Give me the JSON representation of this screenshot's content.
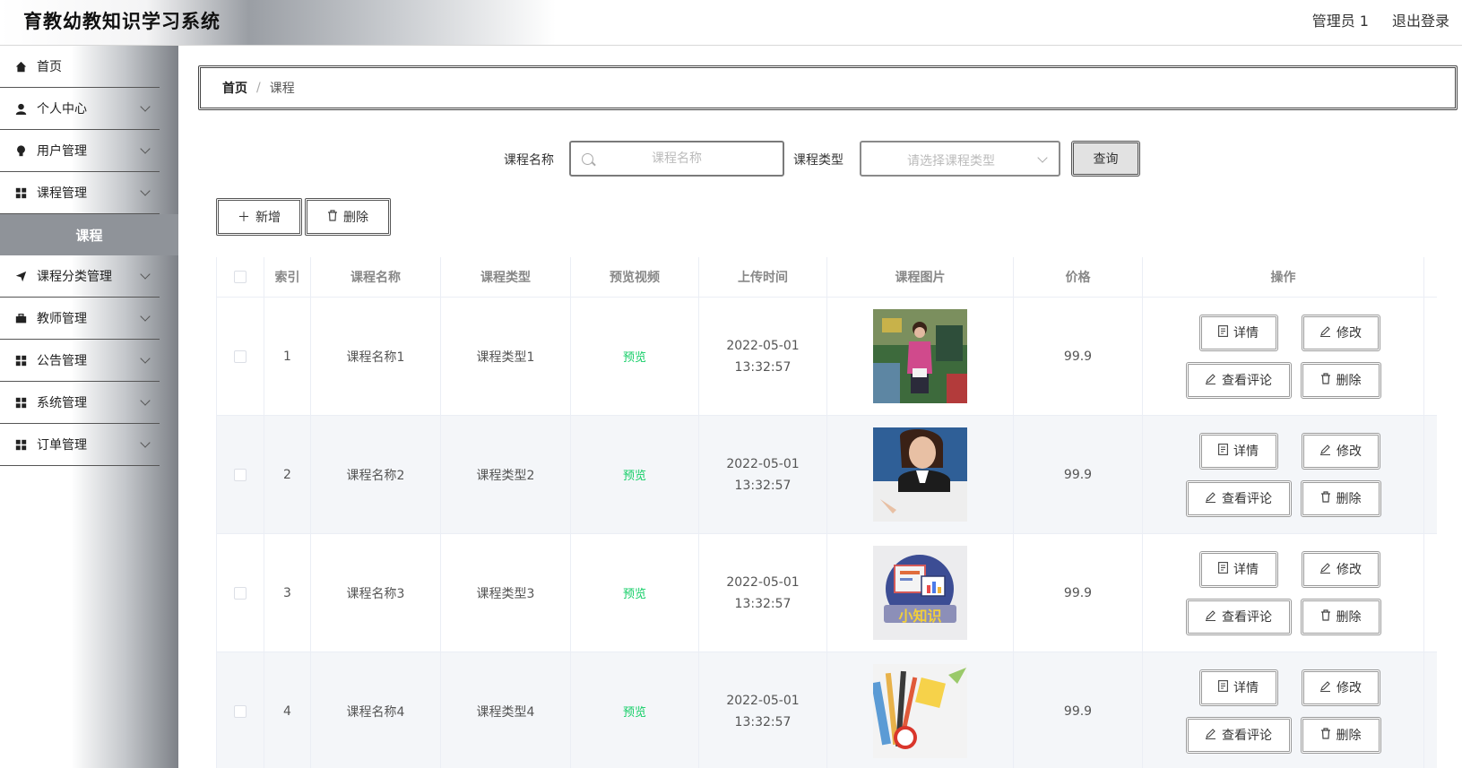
{
  "header": {
    "title": "育教幼教知识学习系统",
    "user": "管理员 1",
    "logout": "退出登录"
  },
  "sidebar": {
    "items": [
      {
        "label": "首页",
        "icon": "home-icon",
        "expandable": false
      },
      {
        "label": "个人中心",
        "icon": "user-icon",
        "expandable": true
      },
      {
        "label": "用户管理",
        "icon": "bulb-icon",
        "expandable": true
      },
      {
        "label": "课程管理",
        "icon": "grid-icon",
        "expandable": true,
        "sub": "课程"
      },
      {
        "label": "课程分类管理",
        "icon": "send-icon",
        "expandable": true
      },
      {
        "label": "教师管理",
        "icon": "briefcase-icon",
        "expandable": true
      },
      {
        "label": "公告管理",
        "icon": "grid-icon",
        "expandable": true
      },
      {
        "label": "系统管理",
        "icon": "grid-icon",
        "expandable": true
      },
      {
        "label": "订单管理",
        "icon": "grid-icon",
        "expandable": true
      }
    ]
  },
  "breadcrumb": {
    "home": "首页",
    "separator": "/",
    "current": "课程"
  },
  "search": {
    "name_label": "课程名称",
    "name_placeholder": "课程名称",
    "name_value": "",
    "type_label": "课程类型",
    "type_placeholder": "请选择课程类型",
    "query_button": "查询"
  },
  "actions": {
    "add": "新增",
    "delete": "删除"
  },
  "table": {
    "columns": [
      "索引",
      "课程名称",
      "课程类型",
      "预览视频",
      "上传时间",
      "课程图片",
      "价格",
      "操作"
    ],
    "rows": [
      {
        "index": "1",
        "name": "课程名称1",
        "type": "课程类型1",
        "preview": "预览",
        "time": "2022-05-01 13:32:57",
        "image": "classroom-teacher-photo",
        "price": "99.9"
      },
      {
        "index": "2",
        "name": "课程名称2",
        "type": "课程类型2",
        "preview": "预览",
        "time": "2022-05-01 13:32:57",
        "image": "businesswoman-pointing-photo",
        "price": "99.9"
      },
      {
        "index": "3",
        "name": "课程名称3",
        "type": "课程类型3",
        "preview": "预览",
        "time": "2022-05-01 13:32:57",
        "image": "xiaozhishi-icon-image",
        "image_text": "小知识",
        "price": "99.9"
      },
      {
        "index": "4",
        "name": "课程名称4",
        "type": "课程类型4",
        "preview": "预览",
        "time": "2022-05-01 13:32:57",
        "image": "stationery-illustration",
        "price": "99.9"
      }
    ],
    "row_ops": {
      "detail": "详情",
      "edit": "修改",
      "comments": "查看评论",
      "delete": "删除"
    }
  },
  "colors": {
    "preview_link": "#13ce66",
    "sidebar_active_bg": "#8f9399",
    "row_alt_bg": "#f4f6f9"
  }
}
